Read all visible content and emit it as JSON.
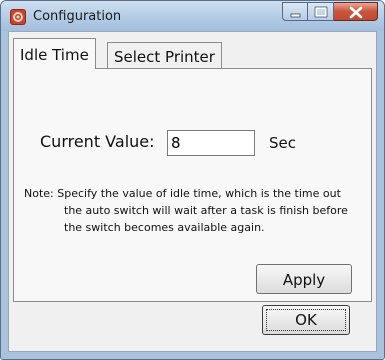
{
  "window": {
    "title": "Configuration",
    "app_icon": "gear-app-icon",
    "caption_buttons": [
      "minimize-icon",
      "maximize-icon",
      "close-icon"
    ]
  },
  "tabs": [
    {
      "label": "Idle Time",
      "active": true
    },
    {
      "label": "Select Printer",
      "active": false
    }
  ],
  "idle_time": {
    "current_value_label": "Current Value:",
    "current_value": "8",
    "unit_label": "Sec",
    "note_lines": [
      "Note: Specify the value of idle time, which is the time out",
      "the auto switch will wait after a task is finish before",
      "the switch becomes available again."
    ],
    "apply_label": "Apply"
  },
  "footer": {
    "ok_label": "OK"
  },
  "colors": {
    "titlebar": "#b7cfe8",
    "close_button": "#c8553b",
    "client_background": "#f0f0f0"
  }
}
